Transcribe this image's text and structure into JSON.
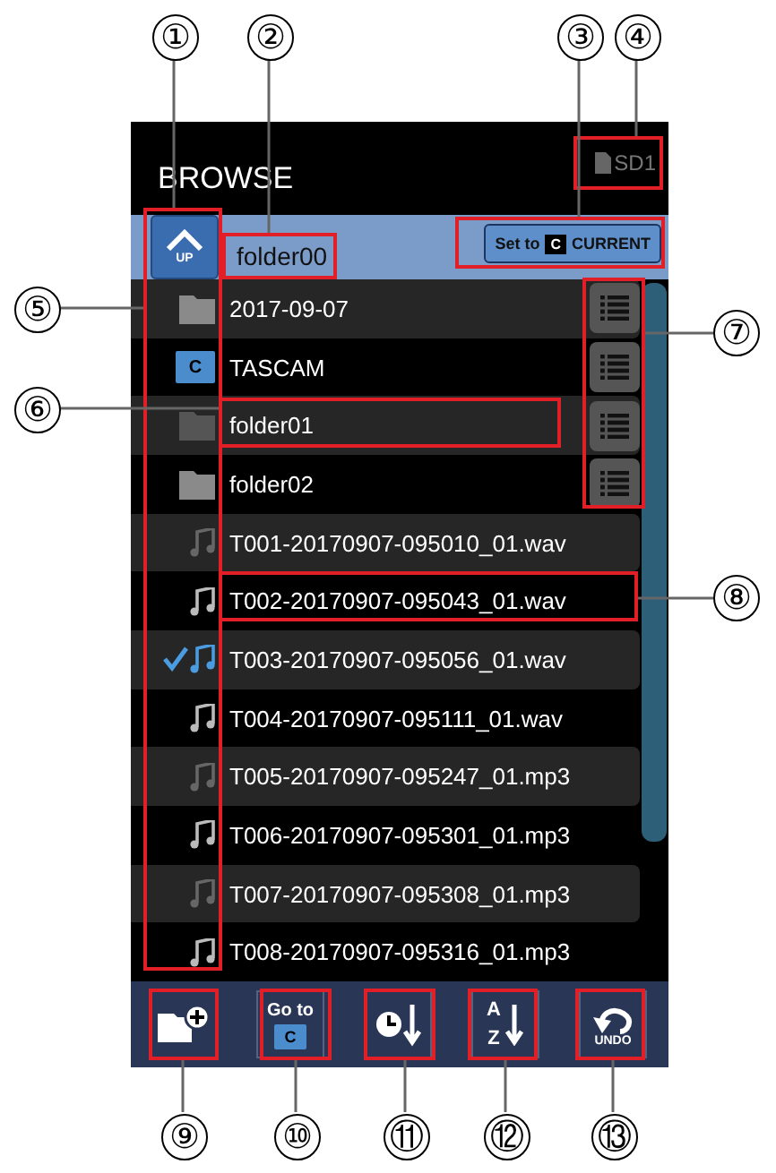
{
  "screen_title": "BROWSE",
  "media": "SD1",
  "up_button": {
    "label": "UP"
  },
  "current_folder": "folder00",
  "set_current_button": {
    "prefix": "Set to",
    "icon_letter": "C",
    "label": "CURRENT"
  },
  "items": [
    {
      "kind": "folder",
      "name": "2017-09-07"
    },
    {
      "kind": "current-folder",
      "name": "TASCAM",
      "icon_letter": "C"
    },
    {
      "kind": "folder",
      "name": "folder01"
    },
    {
      "kind": "folder",
      "name": "folder02"
    },
    {
      "kind": "file",
      "name": "T001-20170907-095010_01.wav",
      "checked": false
    },
    {
      "kind": "file",
      "name": "T002-20170907-095043_01.wav",
      "checked": false
    },
    {
      "kind": "file",
      "name": "T003-20170907-095056_01.wav",
      "checked": true
    },
    {
      "kind": "file",
      "name": "T004-20170907-095111_01.wav",
      "checked": false
    },
    {
      "kind": "file",
      "name": "T005-20170907-095247_01.mp3",
      "checked": false
    },
    {
      "kind": "file",
      "name": "T006-20170907-095301_01.mp3",
      "checked": false
    },
    {
      "kind": "file",
      "name": "T007-20170907-095308_01.mp3",
      "checked": false
    },
    {
      "kind": "file",
      "name": "T008-20170907-095316_01.mp3",
      "checked": false
    }
  ],
  "toolbar": [
    {
      "kind": "new-folder"
    },
    {
      "kind": "go-to",
      "label": "Go to",
      "icon_letter": "C"
    },
    {
      "kind": "sort-time"
    },
    {
      "kind": "sort-name",
      "top": "A",
      "bottom": "Z"
    },
    {
      "kind": "undo",
      "label": "UNDO"
    }
  ],
  "callouts": [
    "①",
    "②",
    "③",
    "④",
    "⑤",
    "⑥",
    "⑦",
    "⑧",
    "⑨",
    "⑩",
    "⑪",
    "⑫",
    "⑬"
  ]
}
